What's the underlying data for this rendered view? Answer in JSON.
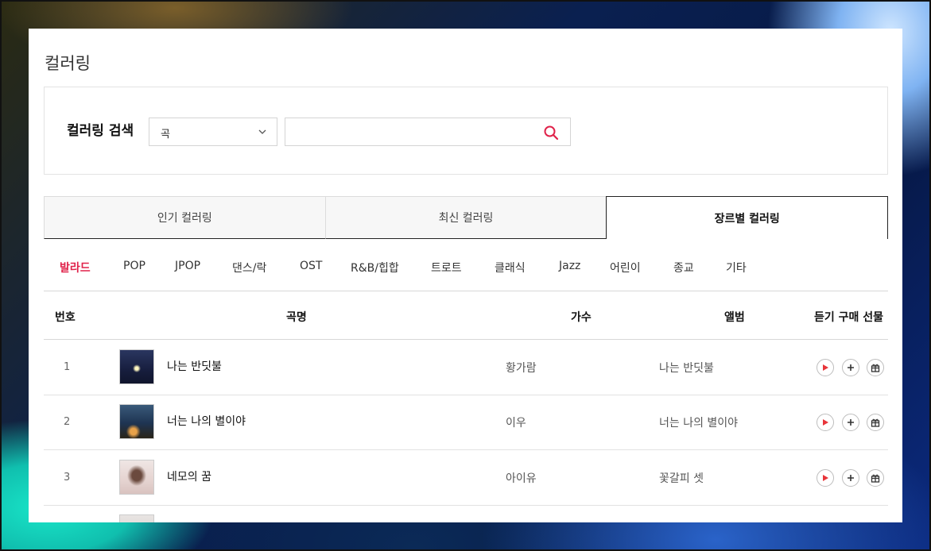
{
  "page": {
    "title": "컬러링"
  },
  "search": {
    "label": "컬러링 검색",
    "select_value": "곡",
    "input_value": "",
    "input_placeholder": ""
  },
  "tabs": [
    {
      "label": "인기 컬러링",
      "active": false
    },
    {
      "label": "최신 컬러링",
      "active": false
    },
    {
      "label": "장르별 컬러링",
      "active": true
    }
  ],
  "genres": [
    {
      "label": "발라드",
      "active": true
    },
    {
      "label": "POP",
      "active": false
    },
    {
      "label": "JPOP",
      "active": false
    },
    {
      "label": "댄스/락",
      "active": false
    },
    {
      "label": "OST",
      "active": false
    },
    {
      "label": "R&B/힙합",
      "active": false
    },
    {
      "label": "트로트",
      "active": false
    },
    {
      "label": "클래식",
      "active": false
    },
    {
      "label": "Jazz",
      "active": false
    },
    {
      "label": "어린이",
      "active": false
    },
    {
      "label": "종교",
      "active": false
    },
    {
      "label": "기타",
      "active": false
    }
  ],
  "table": {
    "headers": {
      "number": "번호",
      "song": "곡명",
      "artist": "가수",
      "album": "앨범",
      "actions": "듣기 구매 선물"
    },
    "rows": [
      {
        "number": "1",
        "title": "나는 반딧불",
        "artist": "황가람",
        "album": "나는 반딧불"
      },
      {
        "number": "2",
        "title": "너는 나의 별이야",
        "artist": "이우",
        "album": "너는 나의 별이야"
      },
      {
        "number": "3",
        "title": "네모의 꿈",
        "artist": "아이유",
        "album": "꽃갈피 셋"
      }
    ]
  },
  "colors": {
    "accent": "#e0224a",
    "play": "#e8353a",
    "border": "#d8d8d8"
  },
  "icons": {
    "select": "chevron-down-icon",
    "search": "search-icon",
    "play": "play-icon",
    "add": "plus-icon",
    "gift": "gift-icon"
  }
}
